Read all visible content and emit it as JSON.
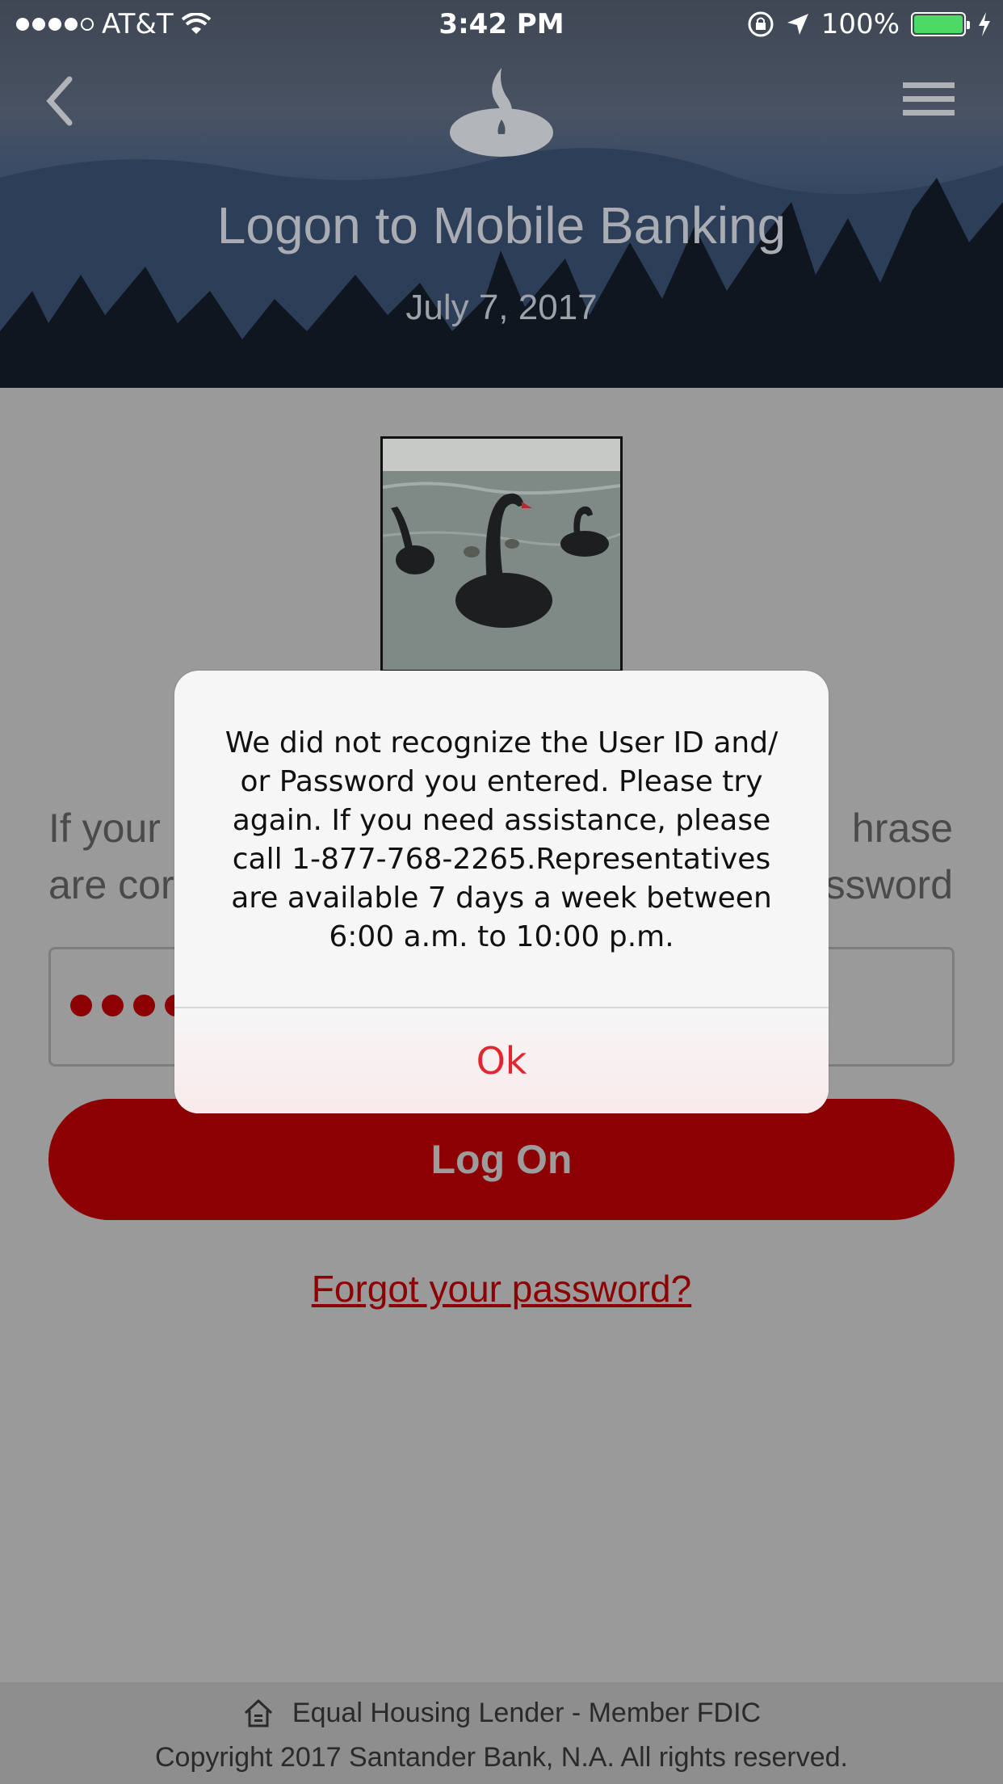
{
  "status_bar": {
    "carrier": "AT&T",
    "time": "3:42 PM",
    "battery": "100%",
    "battery_color": "#4cd964"
  },
  "header": {
    "back_icon": "chevron-left-icon",
    "menu_icon": "hamburger-menu-icon",
    "logo_icon": "santander-flame-logo",
    "title": "Logon to Mobile Banking",
    "date": "July 7, 2017"
  },
  "main": {
    "site_key_image": "black swans on lake",
    "phrase_left_line1": "If your",
    "phrase_left_line2": "are cor",
    "phrase_right_line1": "hrase",
    "phrase_right_line2": "ssword",
    "password_masked_count": 4,
    "logon_label": "Log On",
    "forgot_label": "Forgot your password?"
  },
  "footer": {
    "home_icon": "equal-housing-icon",
    "line1": "Equal Housing Lender - Member FDIC",
    "line2": "Copyright 2017 Santander Bank, N.A. All rights reserved."
  },
  "dialog": {
    "message": "We did not recognize the User ID and/ or Password you entered. Please try again. If you need assistance, please call 1-877-768-2265.Representatives are available 7 days a week between 6:00 a.m. to 10:00 p.m.",
    "ok_label": "Ok"
  },
  "colors": {
    "brand_red": "#8c0004",
    "alert_ok": "#e3252d",
    "overlay_gray": "#9a9a9a"
  }
}
